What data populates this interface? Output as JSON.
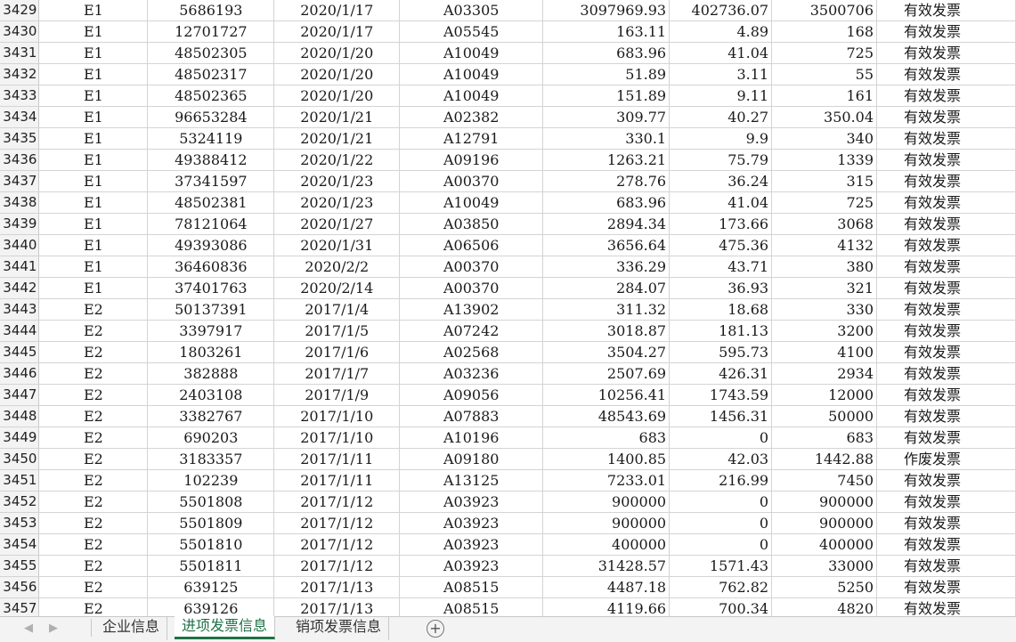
{
  "rows": [
    [
      "3429",
      "E1",
      "5686193",
      "2020/1/17",
      "A03305",
      "3097969.93",
      "402736.07",
      "3500706",
      "有效发票"
    ],
    [
      "3430",
      "E1",
      "12701727",
      "2020/1/17",
      "A05545",
      "163.11",
      "4.89",
      "168",
      "有效发票"
    ],
    [
      "3431",
      "E1",
      "48502305",
      "2020/1/20",
      "A10049",
      "683.96",
      "41.04",
      "725",
      "有效发票"
    ],
    [
      "3432",
      "E1",
      "48502317",
      "2020/1/20",
      "A10049",
      "51.89",
      "3.11",
      "55",
      "有效发票"
    ],
    [
      "3433",
      "E1",
      "48502365",
      "2020/1/20",
      "A10049",
      "151.89",
      "9.11",
      "161",
      "有效发票"
    ],
    [
      "3434",
      "E1",
      "96653284",
      "2020/1/21",
      "A02382",
      "309.77",
      "40.27",
      "350.04",
      "有效发票"
    ],
    [
      "3435",
      "E1",
      "5324119",
      "2020/1/21",
      "A12791",
      "330.1",
      "9.9",
      "340",
      "有效发票"
    ],
    [
      "3436",
      "E1",
      "49388412",
      "2020/1/22",
      "A09196",
      "1263.21",
      "75.79",
      "1339",
      "有效发票"
    ],
    [
      "3437",
      "E1",
      "37341597",
      "2020/1/23",
      "A00370",
      "278.76",
      "36.24",
      "315",
      "有效发票"
    ],
    [
      "3438",
      "E1",
      "48502381",
      "2020/1/23",
      "A10049",
      "683.96",
      "41.04",
      "725",
      "有效发票"
    ],
    [
      "3439",
      "E1",
      "78121064",
      "2020/1/27",
      "A03850",
      "2894.34",
      "173.66",
      "3068",
      "有效发票"
    ],
    [
      "3440",
      "E1",
      "49393086",
      "2020/1/31",
      "A06506",
      "3656.64",
      "475.36",
      "4132",
      "有效发票"
    ],
    [
      "3441",
      "E1",
      "36460836",
      "2020/2/2",
      "A00370",
      "336.29",
      "43.71",
      "380",
      "有效发票"
    ],
    [
      "3442",
      "E1",
      "37401763",
      "2020/2/14",
      "A00370",
      "284.07",
      "36.93",
      "321",
      "有效发票"
    ],
    [
      "3443",
      "E2",
      "50137391",
      "2017/1/4",
      "A13902",
      "311.32",
      "18.68",
      "330",
      "有效发票"
    ],
    [
      "3444",
      "E2",
      "3397917",
      "2017/1/5",
      "A07242",
      "3018.87",
      "181.13",
      "3200",
      "有效发票"
    ],
    [
      "3445",
      "E2",
      "1803261",
      "2017/1/6",
      "A02568",
      "3504.27",
      "595.73",
      "4100",
      "有效发票"
    ],
    [
      "3446",
      "E2",
      "382888",
      "2017/1/7",
      "A03236",
      "2507.69",
      "426.31",
      "2934",
      "有效发票"
    ],
    [
      "3447",
      "E2",
      "2403108",
      "2017/1/9",
      "A09056",
      "10256.41",
      "1743.59",
      "12000",
      "有效发票"
    ],
    [
      "3448",
      "E2",
      "3382767",
      "2017/1/10",
      "A07883",
      "48543.69",
      "1456.31",
      "50000",
      "有效发票"
    ],
    [
      "3449",
      "E2",
      "690203",
      "2017/1/10",
      "A10196",
      "683",
      "0",
      "683",
      "有效发票"
    ],
    [
      "3450",
      "E2",
      "3183357",
      "2017/1/11",
      "A09180",
      "1400.85",
      "42.03",
      "1442.88",
      "作废发票"
    ],
    [
      "3451",
      "E2",
      "102239",
      "2017/1/11",
      "A13125",
      "7233.01",
      "216.99",
      "7450",
      "有效发票"
    ],
    [
      "3452",
      "E2",
      "5501808",
      "2017/1/12",
      "A03923",
      "900000",
      "0",
      "900000",
      "有效发票"
    ],
    [
      "3453",
      "E2",
      "5501809",
      "2017/1/12",
      "A03923",
      "900000",
      "0",
      "900000",
      "有效发票"
    ],
    [
      "3454",
      "E2",
      "5501810",
      "2017/1/12",
      "A03923",
      "400000",
      "0",
      "400000",
      "有效发票"
    ],
    [
      "3455",
      "E2",
      "5501811",
      "2017/1/12",
      "A03923",
      "31428.57",
      "1571.43",
      "33000",
      "有效发票"
    ],
    [
      "3456",
      "E2",
      "639125",
      "2017/1/13",
      "A08515",
      "4487.18",
      "762.82",
      "5250",
      "有效发票"
    ],
    [
      "3457",
      "E2",
      "639126",
      "2017/1/13",
      "A08515",
      "4119.66",
      "700.34",
      "4820",
      "有效发票"
    ]
  ],
  "tabs": {
    "prev_icon": "◀",
    "next_icon": "▶",
    "sheet1": "企业信息",
    "sheet2": "进项发票信息",
    "sheet3": "销项发票信息",
    "add": "+"
  },
  "colors": {
    "active_tab": "#1e7145",
    "grid": "#d4d4d4"
  }
}
